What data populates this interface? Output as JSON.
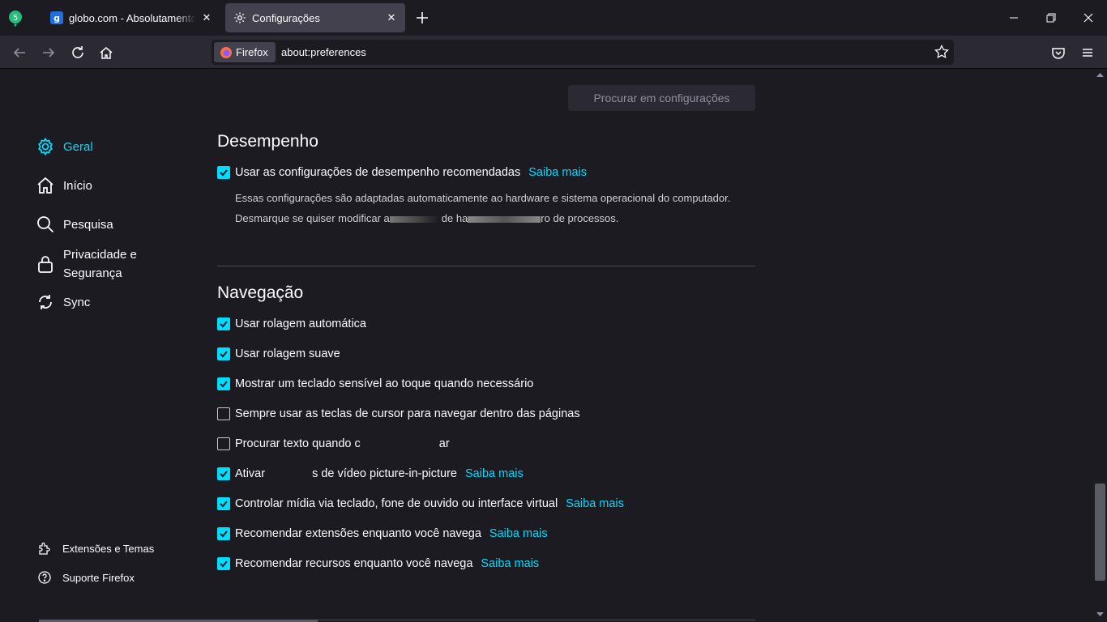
{
  "tabs": [
    {
      "title": "globo.com - Absolutamente tudo",
      "close": "✕"
    },
    {
      "title": "Configurações",
      "close": "✕"
    }
  ],
  "navbar": {
    "identity_label": "Firefox",
    "url": "about:preferences"
  },
  "search": {
    "placeholder": "Procurar em configurações"
  },
  "sidebar": {
    "items": [
      {
        "label": "Geral",
        "icon": "gear-icon",
        "active": true
      },
      {
        "label": "Início",
        "icon": "home-icon"
      },
      {
        "label": "Pesquisa",
        "icon": "search-icon"
      },
      {
        "label": "Privacidade e Segurança",
        "icon": "lock-icon"
      },
      {
        "label": "Sync",
        "icon": "sync-icon"
      }
    ],
    "footer": [
      {
        "label": "Extensões e Temas",
        "icon": "puzzle-icon"
      },
      {
        "label": "Suporte Firefox",
        "icon": "help-icon"
      }
    ]
  },
  "performance": {
    "heading": "Desempenho",
    "checkbox_label": "Usar as configurações de desempenho recomendadas",
    "link": "Saiba mais",
    "desc1": "Essas configurações são adaptadas automaticamente ao hardware e sistema operacional do computador.",
    "desc2": "Desmarque se quiser modificar a",
    "desc2_end": "de ha",
    "desc2_tail": "ro de processos."
  },
  "navigation": {
    "heading": "Navegação",
    "items": [
      {
        "label": "Usar rolagem automática",
        "checked": true
      },
      {
        "label": "Usar rolagem suave",
        "checked": true
      },
      {
        "label": "Mostrar um teclado sensível ao toque quando necessário",
        "checked": true
      },
      {
        "label": "Sempre usar as teclas de cursor para navegar dentro das páginas",
        "checked": false
      },
      {
        "label": "Procurar texto quando c",
        "label_end": "ar",
        "checked": false
      },
      {
        "label": "Ativar",
        "label_end": "s de vídeo picture-in-picture",
        "checked": true,
        "link": "Saiba mais"
      },
      {
        "label": "Controlar mídia via teclado, fone de ouvido ou interface virtual",
        "checked": true,
        "link": "Saiba mais"
      },
      {
        "label": "Recomendar extensões enquanto você navega",
        "checked": true,
        "link": "Saiba mais"
      },
      {
        "label": "Recomendar recursos enquanto você navega",
        "checked": true,
        "link": "Saiba mais"
      }
    ]
  },
  "colors": {
    "accent": "#00ddff",
    "background": "#1c1b22",
    "toolbar": "#2b2a33"
  }
}
